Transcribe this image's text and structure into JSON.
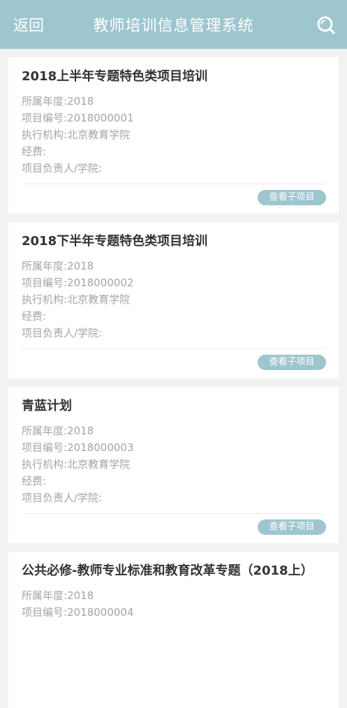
{
  "header": {
    "back_label": "返回",
    "title": "教师培训信息管理系统",
    "search_icon": "search-icon",
    "accent_color": "#9ec6cf"
  },
  "labels": {
    "year": "所属年度:",
    "code": "项目编号:",
    "org": "执行机构:",
    "fee": "经费:",
    "leader": "项目负责人/学院:",
    "sub_button": "查看子项目"
  },
  "projects": [
    {
      "title": "2018上半年专题特色类项目培训",
      "year": "2018",
      "code": "2018000001",
      "org": "北京教育学院",
      "fee": "",
      "leader": ""
    },
    {
      "title": "2018下半年专题特色类项目培训",
      "year": "2018",
      "code": "2018000002",
      "org": "北京教育学院",
      "fee": "",
      "leader": ""
    },
    {
      "title": "青蓝计划",
      "year": "2018",
      "code": "2018000003",
      "org": "北京教育学院",
      "fee": "",
      "leader": ""
    },
    {
      "title": "公共必修-教师专业标准和教育改革专题（2018上）",
      "year": "2018",
      "code": "2018000004",
      "org": "",
      "fee": "",
      "leader": ""
    }
  ]
}
